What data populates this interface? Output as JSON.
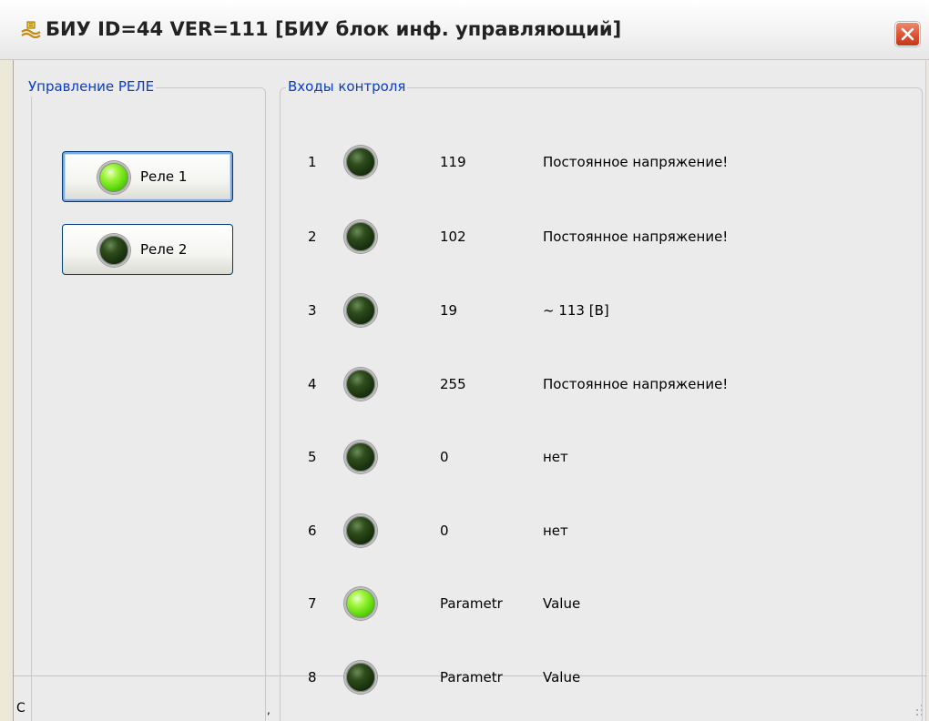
{
  "window": {
    "title": "БИУ ID=44 VER=111 [БИУ блок инф. управляющий]",
    "icon": "app-icon",
    "close_icon": "close-icon"
  },
  "relay_panel": {
    "legend": "Управление РЕЛЕ",
    "buttons": [
      {
        "label": "Реле 1",
        "state": "on",
        "focused": true
      },
      {
        "label": "Реле 2",
        "state": "off",
        "focused": false
      }
    ]
  },
  "inputs_panel": {
    "legend": "Входы контроля",
    "rows": [
      {
        "num": "1",
        "state": "off",
        "param": "119",
        "value": "Постоянное напряжение!"
      },
      {
        "num": "2",
        "state": "off",
        "param": "102",
        "value": "Постоянное напряжение!"
      },
      {
        "num": "3",
        "state": "off",
        "param": "19",
        "value": "~ 113 [В]"
      },
      {
        "num": "4",
        "state": "off",
        "param": "255",
        "value": "Постоянное напряжение!"
      },
      {
        "num": "5",
        "state": "off",
        "param": "0",
        "value": "нет"
      },
      {
        "num": "6",
        "state": "off",
        "param": "0",
        "value": "нет"
      },
      {
        "num": "7",
        "state": "on",
        "param": "Parametr",
        "value": "Value"
      },
      {
        "num": "8",
        "state": "off",
        "param": "Parametr",
        "value": "Value"
      }
    ]
  },
  "status": {
    "left_fragment": "С",
    "mid_fragment": ","
  },
  "colors": {
    "legend_text": "#0a3ccd",
    "led_on": "#5ad60c",
    "led_off": "#132b0b",
    "close_button": "#dc5334",
    "button_border": "#003c74"
  }
}
